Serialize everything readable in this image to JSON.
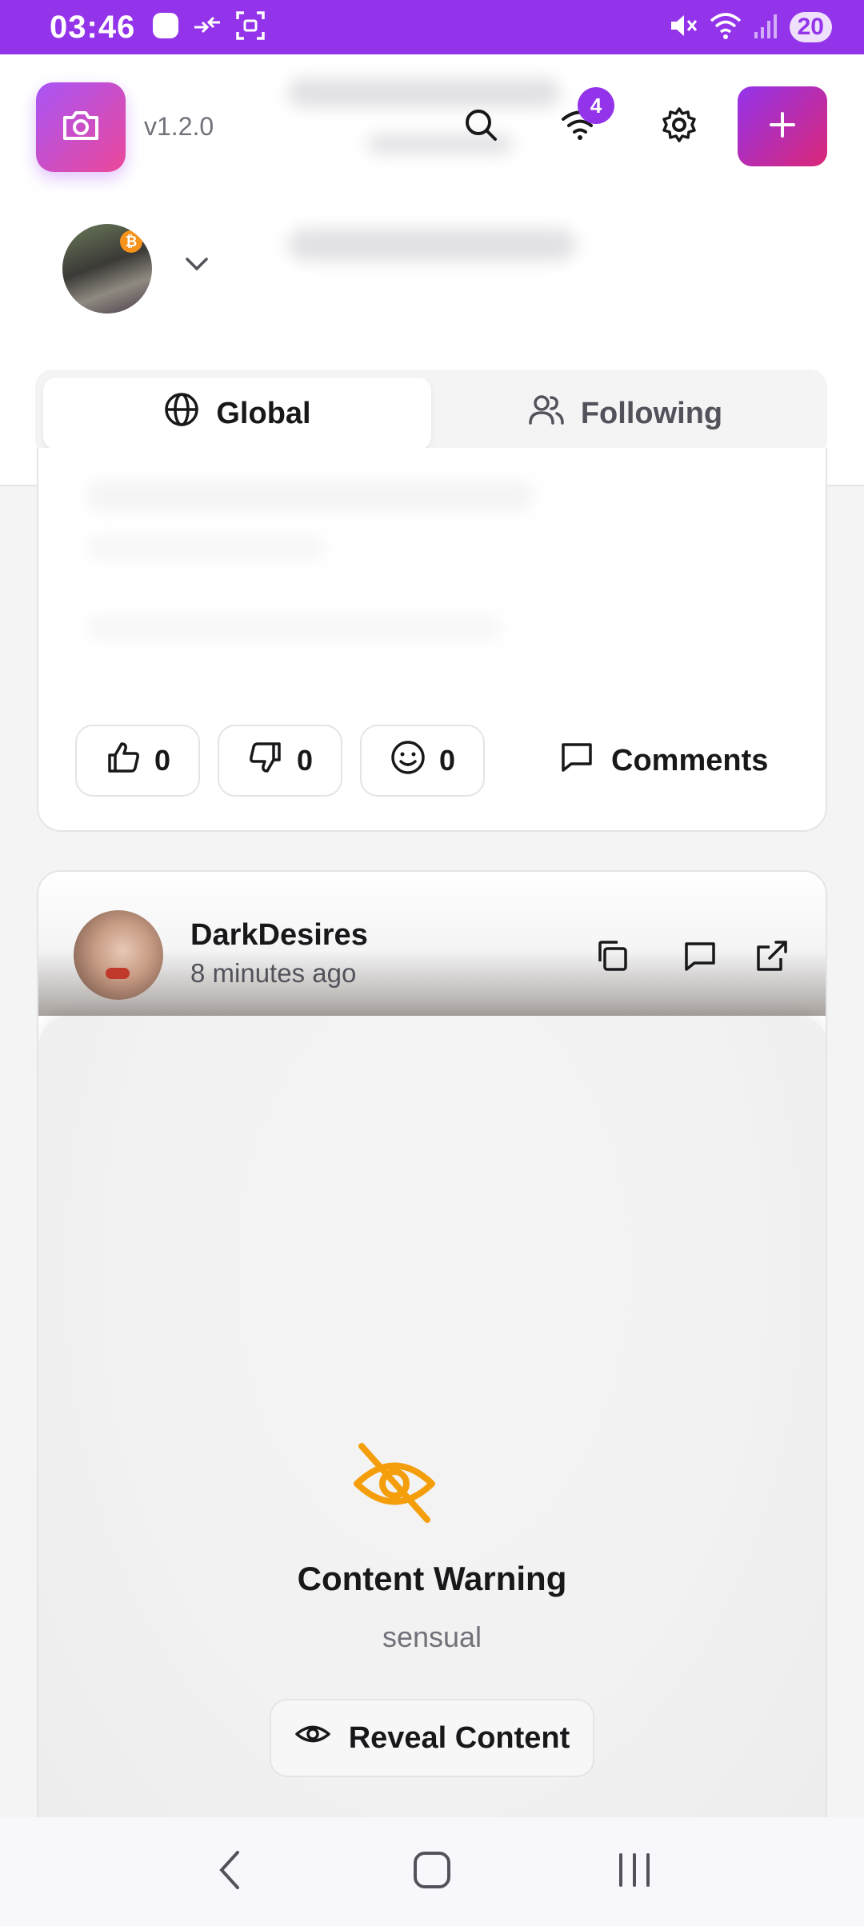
{
  "status_bar": {
    "time": "03:46",
    "battery": "20",
    "icons": [
      "notification-dot-icon",
      "data-transfer-icon",
      "screenshot-icon",
      "mute-icon",
      "wifi-icon",
      "signal-icon"
    ]
  },
  "header": {
    "version": "v1.2.0",
    "relay_badge_count": "4",
    "icons": [
      "camera-icon",
      "search-icon",
      "wifi-icon",
      "gear-icon",
      "plus-icon",
      "chevron-down-icon"
    ],
    "accent_color": "#9333ea",
    "accent_gradient": [
      "#a855f7",
      "#ec4899"
    ]
  },
  "tabs": [
    {
      "label": "Global",
      "icon": "globe-icon",
      "active": true
    },
    {
      "label": "Following",
      "icon": "users-icon",
      "active": false
    }
  ],
  "post1": {
    "reactions": [
      {
        "icon": "thumbs-up-icon",
        "count": "0"
      },
      {
        "icon": "thumbs-down-icon",
        "count": "0"
      },
      {
        "icon": "smile-icon",
        "count": "0"
      }
    ],
    "comments_label": "Comments"
  },
  "post2": {
    "username": "DarkDesires",
    "time_ago": "8 minutes ago",
    "actions": [
      "copy-icon",
      "comment-icon",
      "external-link-icon"
    ],
    "warning": {
      "title": "Content Warning",
      "reason": "sensual",
      "reveal_label": "Reveal Content",
      "icon": "eye-off-icon",
      "icon_color": "#f59e0b"
    }
  },
  "nav_bar": {
    "icons": [
      "back-icon",
      "home-icon",
      "recents-icon"
    ]
  }
}
